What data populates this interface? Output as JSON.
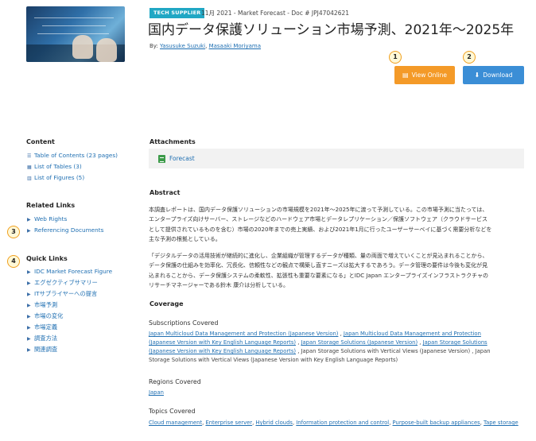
{
  "header": {
    "tag": "TECH SUPPLIER",
    "meta": "11月 2021 - Market Forecast - Doc # JPJ47042621",
    "title": "国内データ保護ソリューション市場予測、2021年～2025年",
    "by_label": "By:",
    "authors": [
      "Yasusuke Suzuki",
      "Masaaki Moriyama"
    ],
    "author_sep": ", "
  },
  "actions": {
    "view_online": "View Online",
    "download": "Download"
  },
  "callouts": [
    "1",
    "2",
    "3",
    "4"
  ],
  "sidebar": {
    "content_heading": "Content",
    "content_items": [
      "Table of Contents (23 pages)",
      "List of Tables (3)",
      "List of Figures (5)"
    ],
    "related_heading": "Related Links",
    "related_items": [
      "Web Rights",
      "Referencing Documents"
    ],
    "quick_heading": "Quick Links",
    "quick_items": [
      "IDC Market Forecast Figure",
      "エグゼクティブサマリー",
      "ITサプライヤーへの提言",
      "市場予測",
      "市場の変化",
      "市場定義",
      "調査方法",
      "関連調査"
    ]
  },
  "attachments": {
    "heading": "Attachments",
    "file": "Forecast",
    "file_icon": "excel-file-icon"
  },
  "abstract": {
    "heading": "Abstract",
    "p1_lines": [
      "本調査レポートは、国内データ保護ソリューションの市場規模を2021年～2025年に渡って予測している。この市場予測に当たっては、",
      "エンタープライズ向けサーバー、ストレージなどのハードウェア市場とデータレプリケーション／保護ソフトウェア（クラウドサービス",
      "として提供されているものを含む）市場の2020年までの売上実績、および2021年1月に行ったユーザーサーベイに基づく需要分析などを",
      "主な予測の根拠としている。"
    ],
    "p2_lines": [
      "「デジタルデータの活用技術が継続的に進化し、企業組織が管理するデータが種類、量の両面で増えていくことが見込まれることから、",
      "データ保護の仕組みを効率化、冗長化、信頼性などの観点で構築し直すニーズは拡大するであろう。データ管理の要件は今後も変化が見",
      "込まれることから、データ保護システムの柔軟性、拡張性も重要な要素になる」とIDC Japan エンタープライズインフラストラクチャの",
      "リサーチマネージャーである鈴木 康介は分析している。"
    ]
  },
  "coverage": {
    "heading": "Coverage",
    "subs_heading": "Subscriptions Covered",
    "subs_links": [
      "Japan Multicloud Data Management and Protection (Japanese Version)",
      "Japan Multicloud Data Management and Protection",
      "(Japanese Version with Key English Language Reports)",
      "Japan Storage Solutions (Japanese Version)",
      "Japan Storage Solutions",
      "(Japanese Version with Key English Language Reports)"
    ],
    "subs_sep": " , ",
    "subs_plain_1": " , Japan Storage Solutions with Vertical Views (Japanese Version) , Japan",
    "subs_plain_2": "Storage Solutions with Vertical Views (Japanese Version with Key English  Language Reports)",
    "regions_heading": "Regions Covered",
    "regions": [
      "Japan"
    ],
    "topics_heading": "Topics Covered",
    "topics": [
      "Cloud management",
      "Enterprise server",
      "Hybrid clouds",
      "Information protection and control",
      "Purpose-built backup appliances",
      "Tape storage"
    ],
    "topic_sep": ", "
  }
}
